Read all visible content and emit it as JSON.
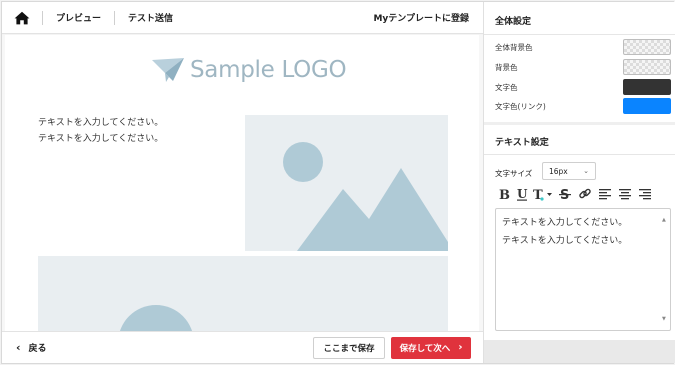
{
  "topbar": {
    "preview_label": "プレビュー",
    "test_send_label": "テスト送信",
    "register_label": "Myテンプレートに登録"
  },
  "canvas": {
    "logo_text": "Sample LOGO",
    "body_lines": [
      "テキストを入力してください。",
      "テキストを入力してください。"
    ]
  },
  "bottombar": {
    "back_label": "戻る",
    "save_here_label": "ここまで保存",
    "save_next_label": "保存して次へ"
  },
  "global_settings": {
    "title": "全体設定",
    "rows": [
      {
        "label": "全体背景色",
        "color": "transparent"
      },
      {
        "label": "背景色",
        "color": "transparent"
      },
      {
        "label": "文字色",
        "color": "#333333"
      },
      {
        "label": "文字色(リンク)",
        "color": "#0a84ff"
      }
    ]
  },
  "text_settings": {
    "title": "テキスト設定",
    "font_size_label": "文字サイズ",
    "font_size_value": "16px",
    "textarea_lines": [
      "テキストを入力してください。",
      "テキストを入力してください。"
    ]
  },
  "icons": {
    "home": "home-icon",
    "logo": "paper-plane-icon",
    "toolbar": [
      "bold-icon",
      "underline-icon",
      "text-color-icon",
      "strikethrough-icon",
      "link-icon",
      "align-left-icon",
      "align-center-icon",
      "align-right-icon"
    ]
  }
}
